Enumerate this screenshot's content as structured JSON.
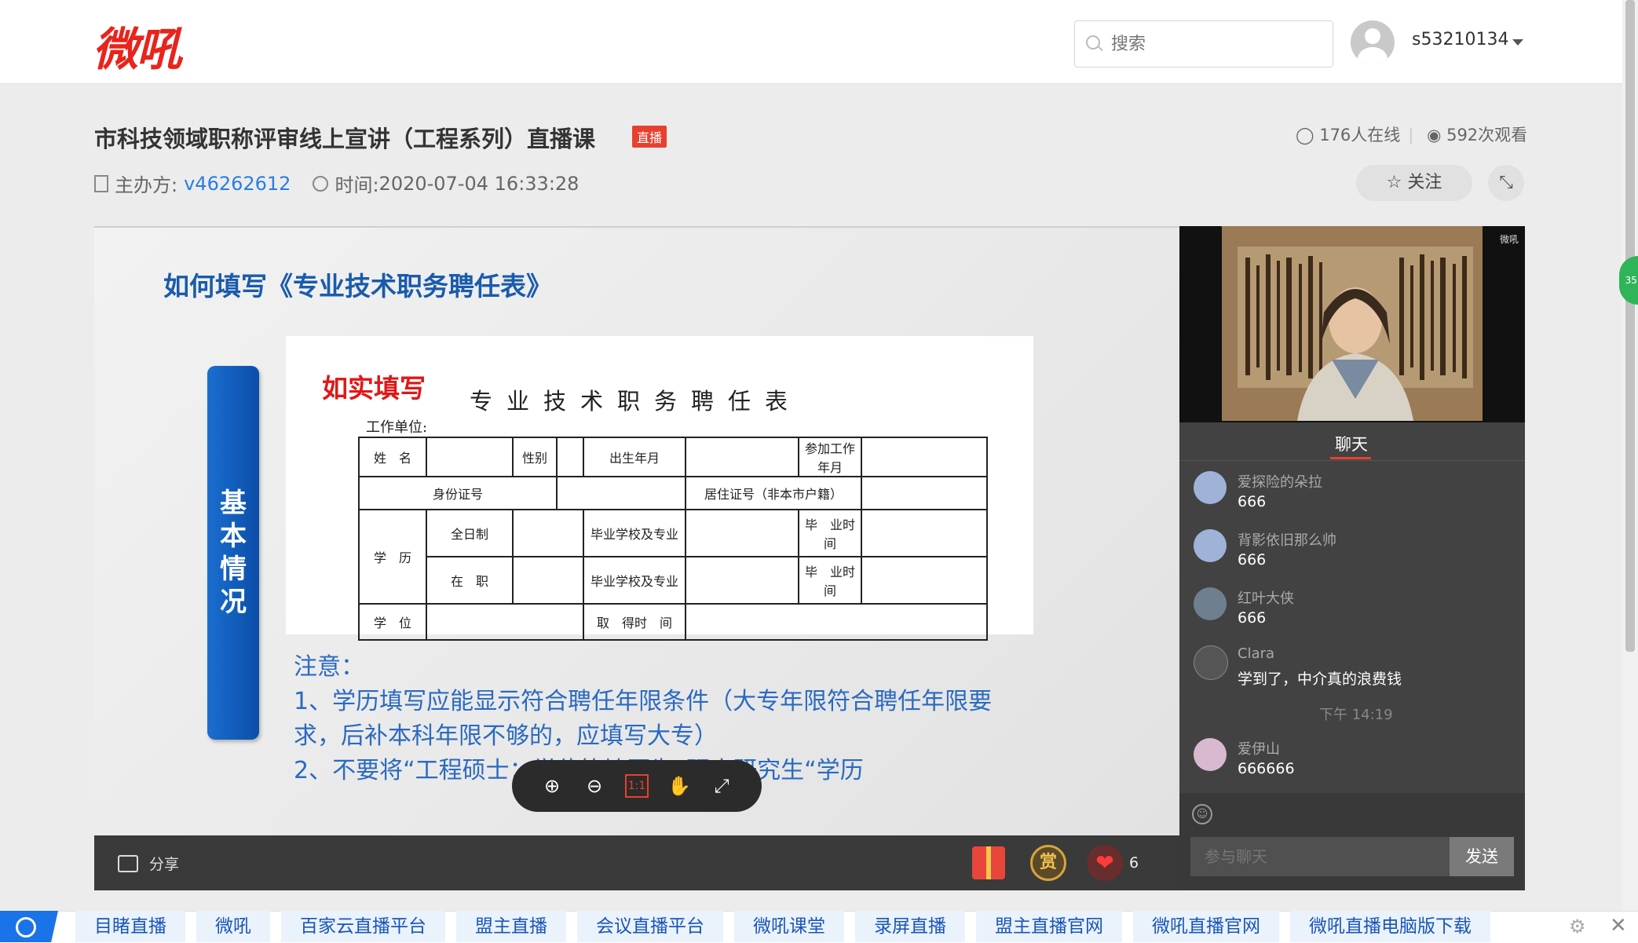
{
  "header": {
    "logo": "微吼",
    "search_placeholder": "搜索",
    "username": "s53210134"
  },
  "event": {
    "title": "市科技领域职称评审线上宣讲（工程系列）直播课",
    "live_badge": "直播",
    "online": "176人在线",
    "views": "592次观看",
    "host_label": "主办方:",
    "host_id": "v46262612",
    "time_label": "时间:",
    "time": "2020-07-04 16:33:28",
    "follow": "关注"
  },
  "slide": {
    "title": "如何填写《专业技术职务聘任表》",
    "side_label": "基本情况",
    "stamp": "如实填写",
    "form_title": "专业技术职务聘任表",
    "form_unit": "工作单位:",
    "form": {
      "name": "姓　名",
      "gender": "性别",
      "birth": "出生年月",
      "work_start": "参加工作年月",
      "id": "身份证号",
      "residence": "居住证号（非本市户籍）",
      "education": "学　历",
      "fulltime": "全日制",
      "parttime": "在　职",
      "school_major": "毕业学校及专业",
      "grad_time": "毕　业时　间",
      "degree": "学　位",
      "degree_time": "取　得时　间"
    },
    "note_lines": [
      "注意：",
      "1、学历填写应能显示符合聘任年限条件（大专年限符合聘任年限要",
      "求，后补本科年限不够的，应填写大专）",
      "2、不要将“工程硕士：学位等填写为”硕士研究生“学历"
    ]
  },
  "player": {
    "share": "分享",
    "reward": "赏",
    "likes": "6",
    "zoom_ratio": "1:1"
  },
  "video": {
    "watermark": "微吼"
  },
  "chat": {
    "tab": "聊天",
    "messages": [
      {
        "name": "爱探险的朵拉",
        "text": "666"
      },
      {
        "name": "背影依旧那么帅",
        "text": "666"
      },
      {
        "name": "红叶大侠",
        "text": "666"
      },
      {
        "name": "Clara",
        "text": "学到了，中介真的浪费钱"
      },
      {
        "name": "爱伊山",
        "text": "666666"
      }
    ],
    "time_divider": "下午 14:19",
    "input_placeholder": "参与聊天",
    "send": "发送"
  },
  "side_bubble": "35",
  "bottom_links": [
    "目睹直播",
    "微吼",
    "百家云直播平台",
    "盟主直播",
    "会议直播平台",
    "微吼课堂",
    "录屏直播",
    "盟主直播官网",
    "微吼直播官网",
    "微吼直播电脑版下载"
  ]
}
